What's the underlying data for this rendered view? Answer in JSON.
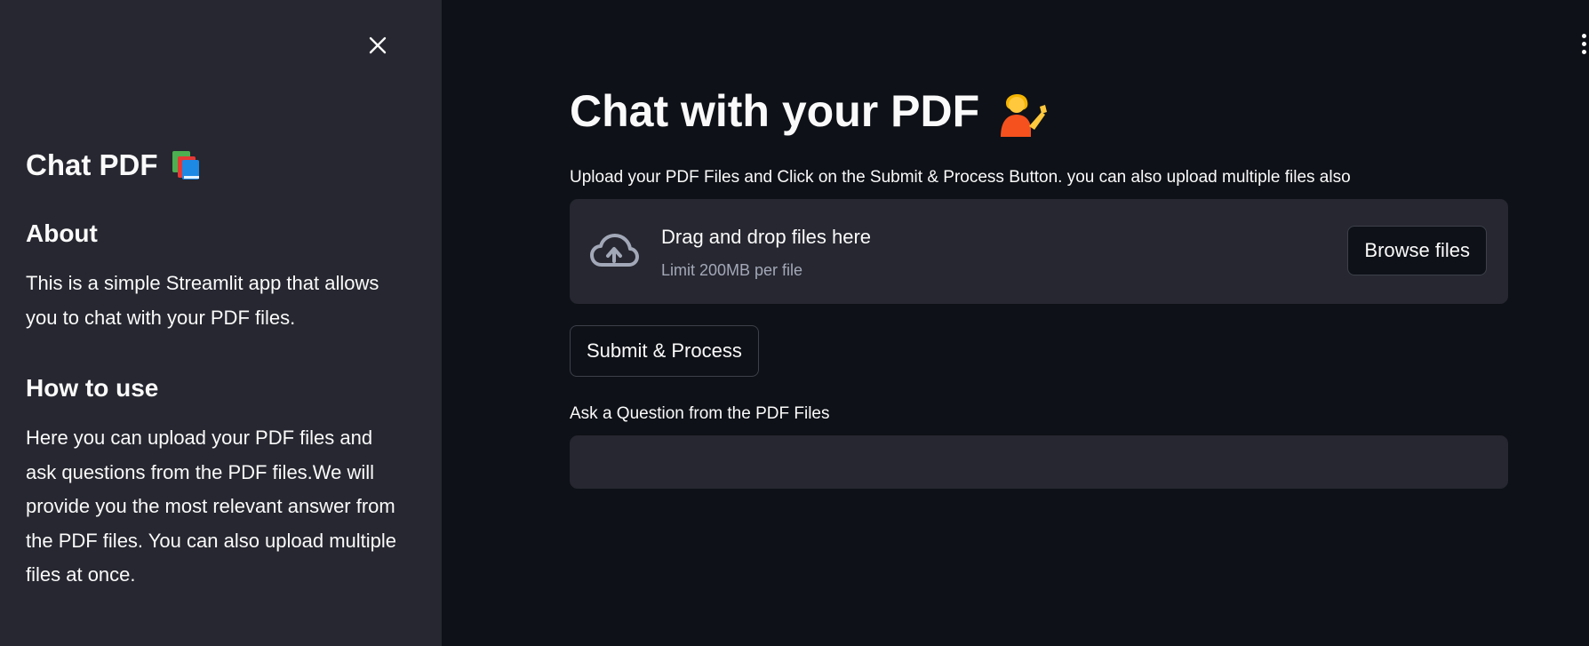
{
  "sidebar": {
    "close_icon": "close-icon",
    "title": "Chat PDF",
    "title_icon": "books-icon",
    "about_heading": "About",
    "about_text": "This is a simple Streamlit app that allows you to chat with your PDF files.",
    "howto_heading": "How to use",
    "howto_text": "Here you can upload your PDF files and ask questions from the PDF files.We will provide you the most relevant answer from the PDF files. You can also upload multiple files at once."
  },
  "header": {
    "menu_icon": "kebab-menu-icon"
  },
  "main": {
    "title": "Chat with your PDF",
    "title_icon": "person-tipping-hand-icon",
    "upload_label": "Upload your PDF Files and Click on the Submit & Process Button. you can also upload multiple files also",
    "dropzone": {
      "icon": "cloud-upload-icon",
      "title": "Drag and drop files here",
      "limit": "Limit 200MB per file",
      "browse_label": "Browse files"
    },
    "submit_label": "Submit & Process",
    "question_label": "Ask a Question from the PDF Files",
    "question_value": ""
  },
  "colors": {
    "background": "#0e1117",
    "sidebar": "#262730",
    "text": "#fafafa",
    "muted_text": "#a3a8b8",
    "border": "#3d404a"
  }
}
